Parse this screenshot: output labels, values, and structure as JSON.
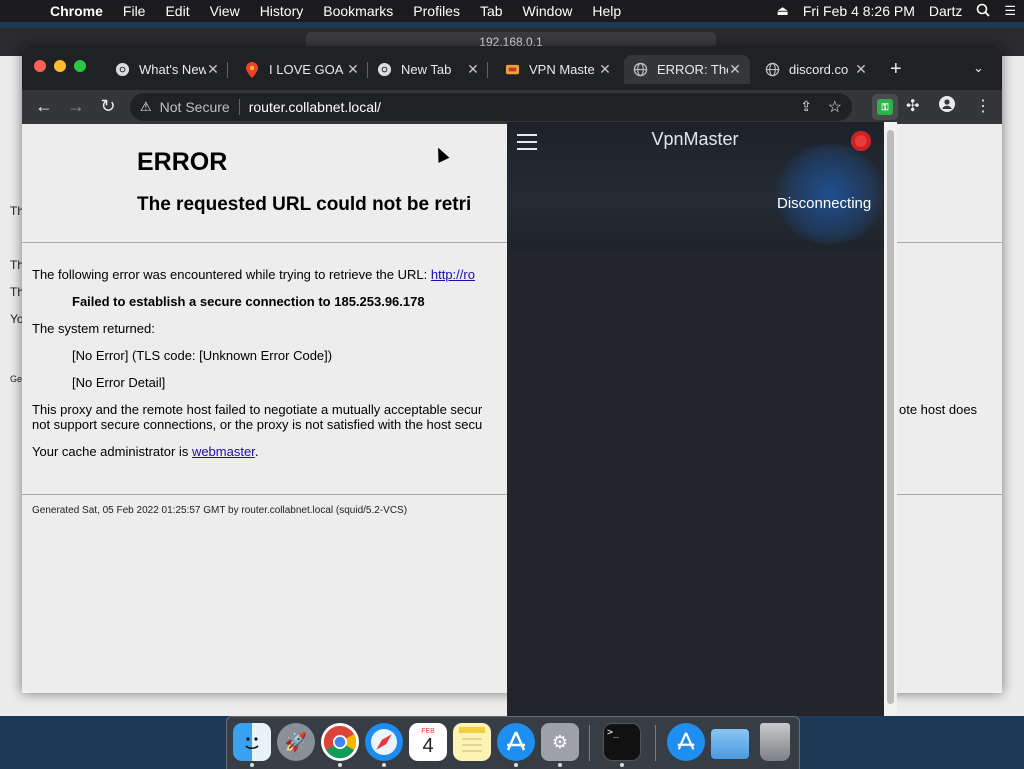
{
  "menubar": {
    "app": "Chrome",
    "items": [
      "File",
      "Edit",
      "View",
      "History",
      "Bookmarks",
      "Profiles",
      "Tab",
      "Window",
      "Help"
    ],
    "datetime": "Fri Feb 4  8:26 PM",
    "user": "Dartz"
  },
  "background_window": {
    "address": "192.168.0.1",
    "snippets": [
      "Th",
      "Th",
      "Th",
      "Yo",
      "Ge"
    ]
  },
  "tabs": [
    {
      "label": "What's New",
      "icon": "chrome-icon"
    },
    {
      "label": "I LOVE GOA",
      "icon": "maps-pin-icon"
    },
    {
      "label": "New Tab",
      "icon": "chrome-icon"
    },
    {
      "label": "VPN Maste",
      "icon": "vpn-favicon-icon"
    },
    {
      "label": "ERROR: The",
      "icon": "globe-icon",
      "active": true
    },
    {
      "label": "discord.co",
      "icon": "globe-icon"
    }
  ],
  "omnibox": {
    "security_label": "Not Secure",
    "url": "router.collabnet.local/"
  },
  "error_page": {
    "title": "ERROR",
    "subtitle": "The requested URL could not be retri",
    "line1_prefix": "The following error was encountered while trying to retrieve the URL: ",
    "line1_link": "http://ro",
    "failed": "Failed to establish a secure connection to 185.253.96.178",
    "system_returned": "The system returned:",
    "tls": "[No Error] (TLS code: [Unknown Error Code])",
    "detail": "[No Error Detail]",
    "proxy_line1": "This proxy and the remote host failed to negotiate a mutually acceptable secur",
    "proxy_line1_tail": "ote host does",
    "proxy_line2": "not support secure connections, or the proxy is not satisfied with the host secu",
    "admin_prefix": "Your cache administrator is ",
    "admin_link": "webmaster",
    "admin_suffix": ".",
    "footer": "Generated Sat, 05 Feb 2022 01:25:57 GMT by router.collabnet.local (squid/5.2-VCS)"
  },
  "vpn_popup": {
    "title": "VpnMaster",
    "status": "Disconnecting"
  },
  "dock": {
    "calendar_month": "FEB",
    "calendar_day": "4"
  },
  "colors": {
    "tabstrip": "#202124",
    "toolbar": "#35363a",
    "popup_bg": "#22252a",
    "link": "#1a0dab"
  }
}
